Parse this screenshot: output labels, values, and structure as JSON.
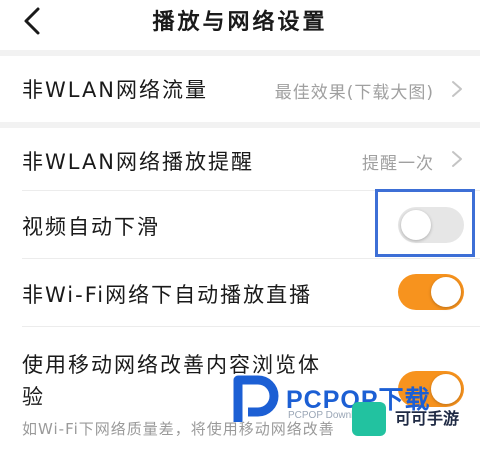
{
  "header": {
    "title": "播放与网络设置",
    "back_icon": "chevron-left-icon"
  },
  "settings": [
    {
      "label": "非WLAN网络流量",
      "value": "最佳效果(下载大图)"
    },
    {
      "label": "非WLAN网络播放提醒",
      "value": "提醒一次"
    },
    {
      "label": "视频自动下滑",
      "toggle": "off"
    },
    {
      "label": "非Wi-Fi网络下自动播放直播",
      "toggle": "on"
    },
    {
      "label_line1": "使用移动网络改善内容浏览体",
      "label_line2": "验",
      "toggle": "on",
      "description": "如Wi-Fi下网络质量差，将使用移动网络改善"
    }
  ],
  "colors": {
    "toggle_on": "#f7931e",
    "toggle_off": "#e6e6e6",
    "highlight": "#3d6fd6",
    "watermark": "#1c5fd4"
  },
  "watermark": {
    "text": "PCPOP下载",
    "sub": "PCPOP Download",
    "brand": "可可手游"
  }
}
